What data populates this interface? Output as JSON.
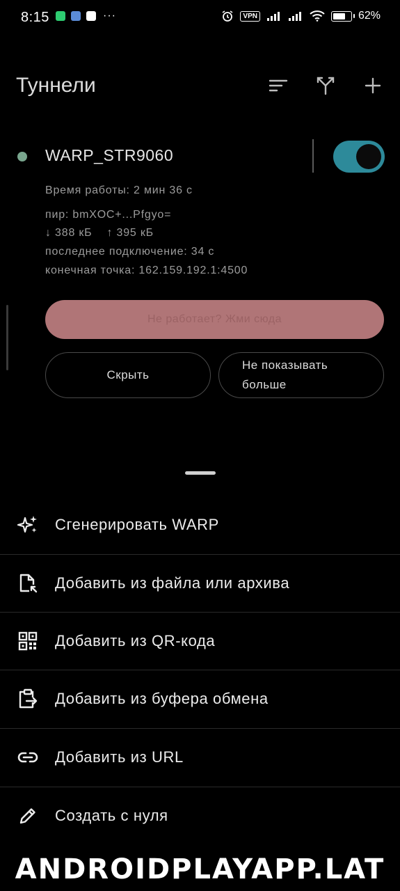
{
  "status_bar": {
    "time": "8:15",
    "vpn": "VPN",
    "battery": "62%",
    "dots": "···"
  },
  "header": {
    "title": "Туннели"
  },
  "tunnel": {
    "name": "WARP_STR9060",
    "enabled": true,
    "uptime": "Время работы: 2 мин 36 с",
    "peer": "пир: bmXOC+...Pfgyo=",
    "traffic": "↓ 388 кБ    ↑ 395 кБ",
    "last_handshake": "последнее подключение: 34 с",
    "endpoint": "конечная точка: 162.159.192.1:4500"
  },
  "banner": {
    "cta": "Не работает? Жми сюда",
    "hide": "Скрыть",
    "never_line1": "Не показывать",
    "never_line2": "больше"
  },
  "sheet": {
    "items": [
      {
        "label": "Сгенерировать WARP",
        "icon": "sparkles-icon"
      },
      {
        "label": "Добавить из файла или архива",
        "icon": "file-import-icon"
      },
      {
        "label": "Добавить из QR-кода",
        "icon": "qr-code-icon"
      },
      {
        "label": "Добавить из буфера обмена",
        "icon": "clipboard-icon"
      },
      {
        "label": "Добавить из URL",
        "icon": "link-icon"
      },
      {
        "label": "Создать с нуля",
        "icon": "pencil-icon"
      }
    ]
  },
  "watermark": "ANDROIDPLAYAPP.LAT",
  "colors": {
    "accent": "#2d8a9a",
    "status_dot": "#79a68e",
    "cta": "#cf8a8c"
  }
}
